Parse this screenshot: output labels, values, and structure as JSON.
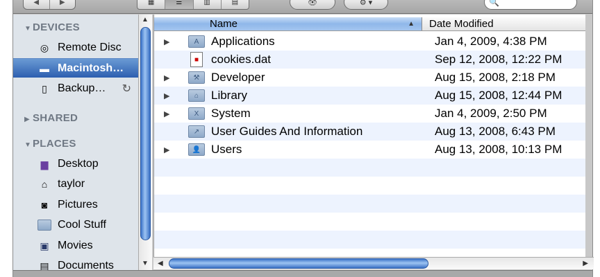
{
  "toolbar": {
    "back_glyph": "◀",
    "forward_glyph": "▶",
    "view_icons": [
      "icon-view-icon",
      "list-view-icon",
      "column-view-icon",
      "coverflow-view-icon"
    ],
    "view_glyphs": [
      "▦",
      "☰",
      "▥",
      "▤"
    ],
    "quicklook_glyph": "👁",
    "action_glyph": "⚙ ▾",
    "search_glyph": "🔍"
  },
  "sidebar": {
    "devices_header": "DEVICES",
    "shared_header": "SHARED",
    "places_header": "PLACES",
    "devices": [
      {
        "label": "Remote Disc",
        "icon": "disc-icon",
        "glyph": "◎"
      },
      {
        "label": "Macintosh…",
        "icon": "hard-drive-icon",
        "glyph": "▬"
      },
      {
        "label": "Backup…",
        "icon": "drive-icon",
        "glyph": "▯"
      }
    ],
    "places": [
      {
        "label": "Desktop",
        "icon": "desktop-icon",
        "glyph": "▆"
      },
      {
        "label": "taylor",
        "icon": "home-icon",
        "glyph": "⌂"
      },
      {
        "label": "Pictures",
        "icon": "camera-icon",
        "glyph": "◙"
      },
      {
        "label": "Cool Stuff",
        "icon": "folder-icon",
        "glyph": ""
      },
      {
        "label": "Movies",
        "icon": "film-icon",
        "glyph": "▣"
      },
      {
        "label": "Documents",
        "icon": "document-icon",
        "glyph": "▤"
      }
    ],
    "sync_glyph": "↻"
  },
  "list": {
    "col_name": "Name",
    "col_date": "Date Modified",
    "sort_glyph": "▲",
    "rows": [
      {
        "name": "Applications",
        "date": "Jan 4, 2009, 4:38 PM",
        "expandable": true,
        "icon": "applications-folder-icon",
        "glyph": "A"
      },
      {
        "name": "cookies.dat",
        "date": "Sep 12, 2008, 12:22 PM",
        "expandable": false,
        "icon": "file-icon",
        "glyph": "■"
      },
      {
        "name": "Developer",
        "date": "Aug 15, 2008, 2:18 PM",
        "expandable": true,
        "icon": "developer-folder-icon",
        "glyph": "⚒"
      },
      {
        "name": "Library",
        "date": "Aug 15, 2008, 12:44 PM",
        "expandable": true,
        "icon": "library-folder-icon",
        "glyph": "⌂"
      },
      {
        "name": "System",
        "date": "Jan 4, 2009, 2:50 PM",
        "expandable": true,
        "icon": "system-folder-icon",
        "glyph": "X"
      },
      {
        "name": "User Guides And Information",
        "date": "Aug 13, 2008, 6:43 PM",
        "expandable": false,
        "icon": "alias-folder-icon",
        "glyph": "↗"
      },
      {
        "name": "Users",
        "date": "Aug 13, 2008, 10:13 PM",
        "expandable": true,
        "icon": "users-folder-icon",
        "glyph": "👤"
      }
    ],
    "disclosure_glyph": "▶"
  },
  "scroll": {
    "up_glyph": "▲",
    "down_glyph": "▼",
    "left_glyph": "◀",
    "right_glyph": "▶"
  }
}
